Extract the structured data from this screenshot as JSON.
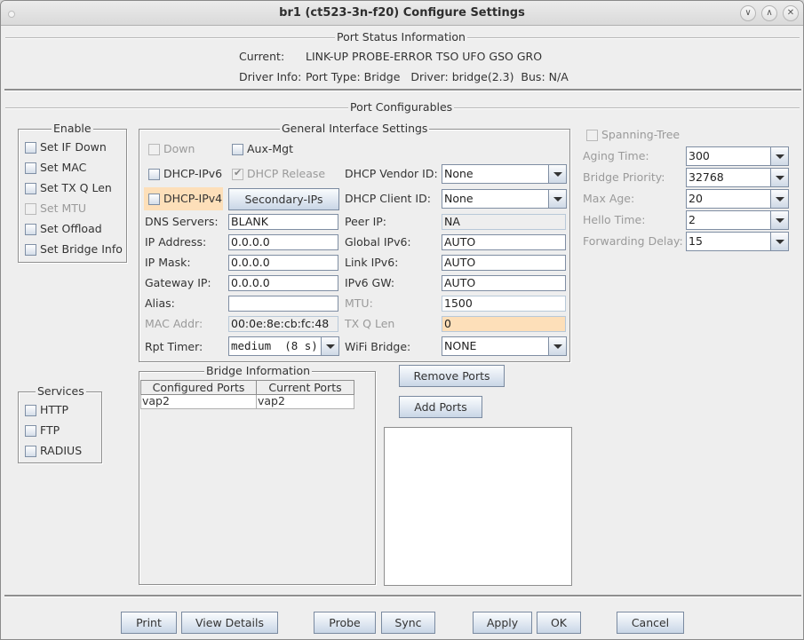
{
  "window": {
    "title": "br1  (ct523-3n-f20) Configure Settings",
    "controls": [
      "minimize",
      "maximize",
      "close"
    ]
  },
  "port_status": {
    "heading": "Port Status Information",
    "current_label": "Current:",
    "current_value": "LINK-UP PROBE-ERROR TSO UFO GSO GRO",
    "driver_label": "Driver Info:",
    "driver_value": "Port Type: Bridge   Driver: bridge(2.3)  Bus: N/A"
  },
  "configurables": {
    "heading": "Port Configurables"
  },
  "enable": {
    "heading": "Enable",
    "items": [
      {
        "label": "Set IF Down",
        "checked": false,
        "disabled": false
      },
      {
        "label": "Set MAC",
        "checked": false,
        "disabled": false
      },
      {
        "label": "Set TX Q Len",
        "checked": false,
        "disabled": false
      },
      {
        "label": "Set MTU",
        "checked": false,
        "disabled": true
      },
      {
        "label": "Set Offload",
        "checked": false,
        "disabled": false
      },
      {
        "label": "Set Bridge Info",
        "checked": false,
        "disabled": false
      }
    ]
  },
  "services": {
    "heading": "Services",
    "items": [
      {
        "label": "HTTP",
        "checked": false
      },
      {
        "label": "FTP",
        "checked": false
      },
      {
        "label": "RADIUS",
        "checked": false
      }
    ]
  },
  "general": {
    "heading": "General Interface Settings",
    "down_label": "Down",
    "aux_mgt_label": "Aux-Mgt",
    "dhcp_ipv6_label": "DHCP-IPv6",
    "dhcp_release_label": "DHCP Release",
    "dhcp_ipv4_label": "DHCP-IPv4",
    "secondary_ips_button": "Secondary-IPs",
    "dns_servers_label": "DNS Servers:",
    "dns_servers_value": "BLANK",
    "ip_address_label": "IP Address:",
    "ip_address_value": "0.0.0.0",
    "ip_mask_label": "IP Mask:",
    "ip_mask_value": "0.0.0.0",
    "gateway_ip_label": "Gateway IP:",
    "gateway_ip_value": "0.0.0.0",
    "alias_label": "Alias:",
    "alias_value": "",
    "mac_addr_label": "MAC Addr:",
    "mac_addr_value": "00:0e:8e:cb:fc:48",
    "rpt_timer_label": "Rpt Timer:",
    "rpt_timer_value": "medium  (8 s)",
    "dhcp_vendor_id_label": "DHCP Vendor ID:",
    "dhcp_vendor_id_value": "None",
    "dhcp_client_id_label": "DHCP Client ID:",
    "dhcp_client_id_value": "None",
    "peer_ip_label": "Peer IP:",
    "peer_ip_value": "NA",
    "global_ipv6_label": "Global IPv6:",
    "global_ipv6_value": "AUTO",
    "link_ipv6_label": "Link IPv6:",
    "link_ipv6_value": "AUTO",
    "ipv6_gw_label": "IPv6 GW:",
    "ipv6_gw_value": "AUTO",
    "mtu_label": "MTU:",
    "mtu_value": "1500",
    "tx_q_len_label": "TX Q Len",
    "tx_q_len_value": "0",
    "wifi_bridge_label": "WiFi Bridge:",
    "wifi_bridge_value": "NONE"
  },
  "stp": {
    "spanning_tree_label": "Spanning-Tree",
    "aging_time_label": "Aging Time:",
    "aging_time_value": "300",
    "bridge_priority_label": "Bridge Priority:",
    "bridge_priority_value": "32768",
    "max_age_label": "Max Age:",
    "max_age_value": "20",
    "hello_time_label": "Hello Time:",
    "hello_time_value": "2",
    "forwarding_delay_label": "Forwarding Delay:",
    "forwarding_delay_value": "15"
  },
  "bridge": {
    "heading": "Bridge Information",
    "columns": [
      "Configured Ports",
      "Current Ports"
    ],
    "rows": [
      [
        "vap2",
        "vap2"
      ]
    ],
    "remove_ports_button": "Remove Ports",
    "add_ports_button": "Add Ports"
  },
  "footer": {
    "print": "Print",
    "view_details": "View Details",
    "probe": "Probe",
    "sync": "Sync",
    "apply": "Apply",
    "ok": "OK",
    "cancel": "Cancel"
  }
}
